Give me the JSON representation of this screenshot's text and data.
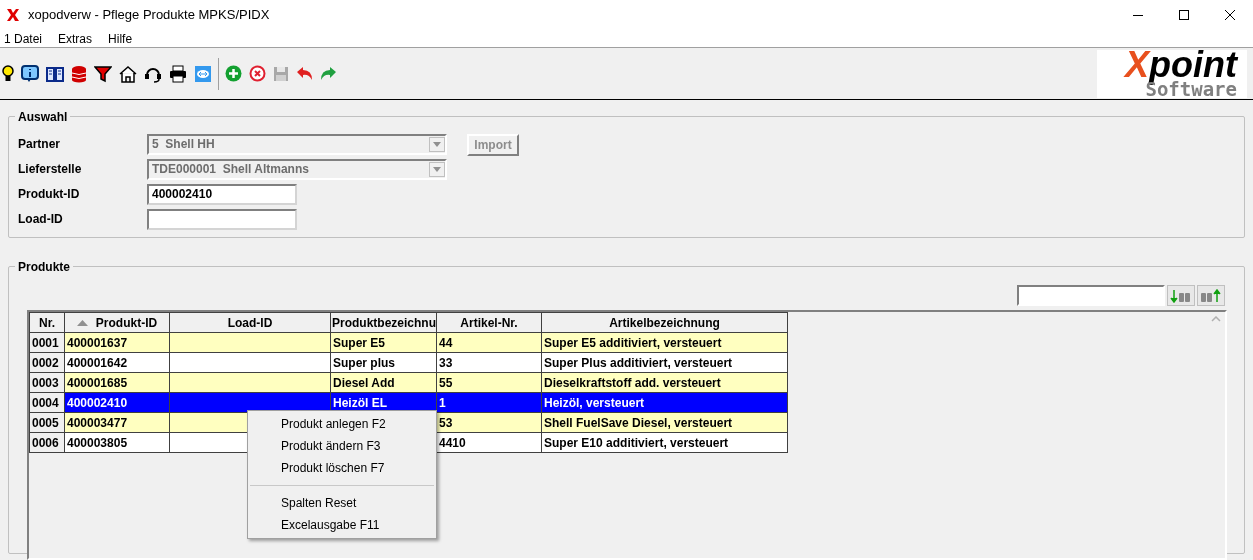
{
  "window": {
    "title": "xopodverw - Pflege Produkte MPKS/PIDX"
  },
  "menu": [
    "1 Datei",
    "Extras",
    "Hilfe"
  ],
  "logo": {
    "mark": "X",
    "rest": "point",
    "subtitle": "Software"
  },
  "auswahl": {
    "title": "Auswahl",
    "fields": [
      {
        "kind": "combo",
        "label": "Partner",
        "value": "5  Shell HH",
        "disabled": true
      },
      {
        "kind": "combo",
        "label": "Lieferstelle",
        "value": "TDE000001  Shell Altmanns",
        "disabled": true
      },
      {
        "kind": "text",
        "label": "Produkt-ID",
        "value": "400002410",
        "disabled": false
      },
      {
        "kind": "text",
        "label": "Load-ID",
        "disabled": false
      }
    ],
    "import_button": {
      "label": "Import",
      "disabled": true
    }
  },
  "produkte": {
    "title": "Produkte",
    "columns": [
      "Nr.",
      "Produkt-ID",
      "Load-ID",
      "Produktbezeichnu",
      "Artikel-Nr.",
      "Artikelbezeichnung"
    ],
    "rows": [
      {
        "selected": false,
        "cells": [
          "0001",
          "400001637",
          "",
          "Super E5",
          "44",
          "Super E5 additiviert, versteuert"
        ]
      },
      {
        "selected": false,
        "cells": [
          "0002",
          "400001642",
          "",
          "Super plus",
          "33",
          "Super Plus additiviert, versteuert"
        ]
      },
      {
        "selected": false,
        "cells": [
          "0003",
          "400001685",
          "",
          "Diesel Add",
          "55",
          "Dieselkraftstoff add. versteuert"
        ]
      },
      {
        "selected": true,
        "cells": [
          "0004",
          "400002410",
          "",
          "Heizöl EL",
          "1",
          "Heizöl, versteuert"
        ]
      },
      {
        "selected": false,
        "cells": [
          "0005",
          "400003477",
          "",
          "",
          "53",
          "Shell FuelSave Diesel, versteuert"
        ]
      },
      {
        "selected": false,
        "cells": [
          "0006",
          "400003805",
          "",
          "",
          "4410",
          "Super E10 additiviert, versteuert"
        ]
      }
    ]
  },
  "context_menu": [
    {
      "kind": "item",
      "label": "Produkt anlegen F2"
    },
    {
      "kind": "item",
      "label": "Produkt ändern F3"
    },
    {
      "kind": "item",
      "label": "Produkt löschen F7"
    },
    {
      "kind": "separator"
    },
    {
      "kind": "item",
      "label": "Spalten Reset"
    },
    {
      "kind": "item",
      "label": "Excelausgabe F11"
    }
  ]
}
